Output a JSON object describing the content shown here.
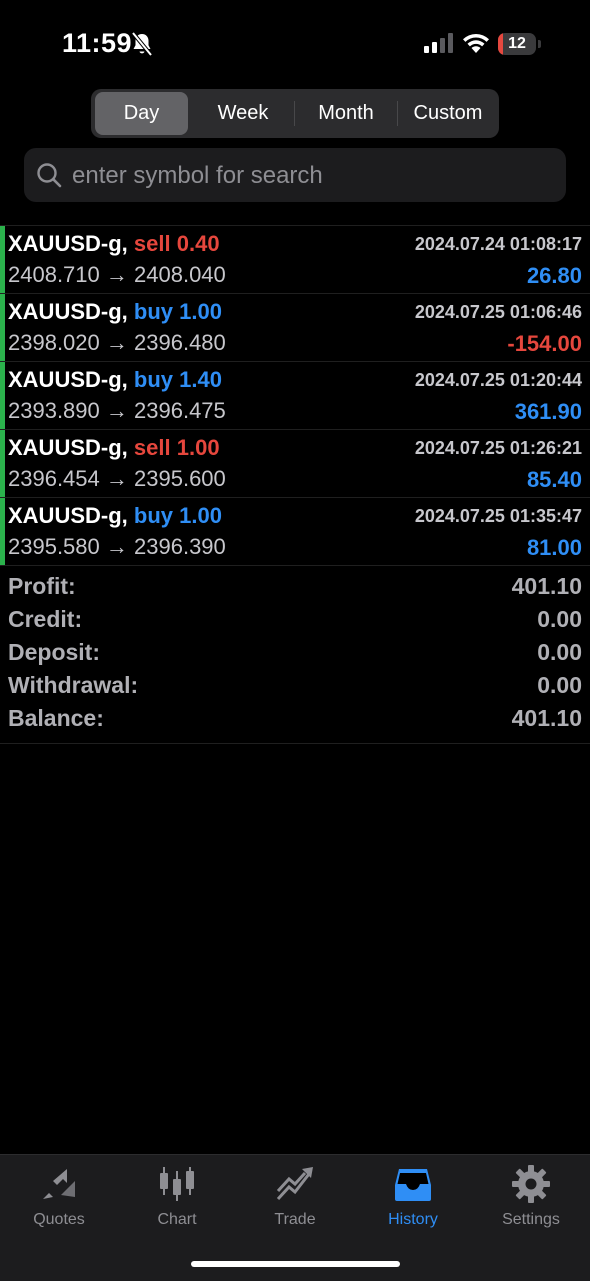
{
  "status_bar": {
    "time": "11:59",
    "battery_level": "12",
    "battery_fraction": 0.12
  },
  "period_tabs": [
    {
      "label": "Day",
      "active": true
    },
    {
      "label": "Week",
      "active": false
    },
    {
      "label": "Month",
      "active": false
    },
    {
      "label": "Custom",
      "active": false
    }
  ],
  "search": {
    "placeholder": "enter symbol for search",
    "value": ""
  },
  "trades": [
    {
      "symbol": "XAUUSD-g,",
      "side": "sell",
      "volume": "0.40",
      "date": "2024.07.24 01:08:17",
      "open": "2408.710",
      "arrow": "→",
      "close": "2408.040",
      "profit": "26.80"
    },
    {
      "symbol": "XAUUSD-g,",
      "side": "buy",
      "volume": "1.00",
      "date": "2024.07.25 01:06:46",
      "open": "2398.020",
      "arrow": "→",
      "close": "2396.480",
      "profit": "-154.00"
    },
    {
      "symbol": "XAUUSD-g,",
      "side": "buy",
      "volume": "1.40",
      "date": "2024.07.25 01:20:44",
      "open": "2393.890",
      "arrow": "→",
      "close": "2396.475",
      "profit": "361.90"
    },
    {
      "symbol": "XAUUSD-g,",
      "side": "sell",
      "volume": "1.00",
      "date": "2024.07.25 01:26:21",
      "open": "2396.454",
      "arrow": "→",
      "close": "2395.600",
      "profit": "85.40"
    },
    {
      "symbol": "XAUUSD-g,",
      "side": "buy",
      "volume": "1.00",
      "date": "2024.07.25 01:35:47",
      "open": "2395.580",
      "arrow": "→",
      "close": "2396.390",
      "profit": "81.00"
    }
  ],
  "summary": [
    {
      "label": "Profit:",
      "value": "401.10"
    },
    {
      "label": "Credit:",
      "value": "0.00"
    },
    {
      "label": "Deposit:",
      "value": "0.00"
    },
    {
      "label": "Withdrawal:",
      "value": "0.00"
    },
    {
      "label": "Balance:",
      "value": "401.10"
    }
  ],
  "tab_bar": [
    {
      "label": "Quotes",
      "icon": "quotes-icon",
      "active": false
    },
    {
      "label": "Chart",
      "icon": "chart-icon",
      "active": false
    },
    {
      "label": "Trade",
      "icon": "trade-icon",
      "active": false
    },
    {
      "label": "History",
      "icon": "history-icon",
      "active": true
    },
    {
      "label": "Settings",
      "icon": "settings-icon",
      "active": false
    }
  ],
  "colors": {
    "sell": "#e6473d",
    "buy": "#2f8ef5",
    "loss": "#e6473d",
    "gain": "#2f8ef5",
    "position_bar": "#2bb24c",
    "active_tab": "#2f8ef5"
  }
}
